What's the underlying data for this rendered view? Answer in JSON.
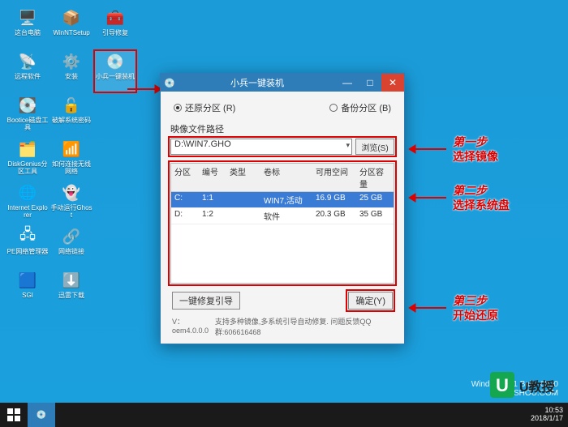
{
  "desktop": {
    "icons": [
      {
        "name": "this-pc",
        "label": "这台电脑",
        "glyph": "🖥️"
      },
      {
        "name": "winntsetup",
        "label": "WinNTSetup",
        "glyph": "📦"
      },
      {
        "name": "boot-repair",
        "label": "引导修复",
        "glyph": "🧰"
      },
      {
        "name": "remote-software",
        "label": "远程软件",
        "glyph": "📡"
      },
      {
        "name": "install",
        "label": "安装",
        "glyph": "⚙️"
      },
      {
        "name": "xiaobing",
        "label": "小兵一键装机",
        "glyph": "💿",
        "hl": true
      },
      {
        "name": "bootice",
        "label": "Bootice磁盘工具",
        "glyph": "💽"
      },
      {
        "name": "crack-pwd",
        "label": "破解系统密码",
        "glyph": "🔓"
      },
      {
        "name": "blank1",
        "label": "",
        "glyph": ""
      },
      {
        "name": "diskgenius",
        "label": "DiskGenius分区工具",
        "glyph": "🗂️"
      },
      {
        "name": "wifi-connect",
        "label": "如何连接无线网络",
        "glyph": "📶"
      },
      {
        "name": "blank2",
        "label": "",
        "glyph": ""
      },
      {
        "name": "ie",
        "label": "Internet Explorer",
        "glyph": "🌐"
      },
      {
        "name": "manual-ghost",
        "label": "手动运行Ghost",
        "glyph": "👻"
      },
      {
        "name": "blank3",
        "label": "",
        "glyph": ""
      },
      {
        "name": "pe-net",
        "label": "PE网络管理器",
        "glyph": "🖧"
      },
      {
        "name": "net-link",
        "label": "网络链接",
        "glyph": "🔗"
      },
      {
        "name": "blank4",
        "label": "",
        "glyph": ""
      },
      {
        "name": "sgi",
        "label": "SGI",
        "glyph": "🟦"
      },
      {
        "name": "xunlei",
        "label": "迅雷下载",
        "glyph": "⬇️"
      },
      {
        "name": "blank5",
        "label": "",
        "glyph": ""
      }
    ]
  },
  "window": {
    "title": "小兵一键装机",
    "restore_label": "还原分区 (R)",
    "backup_label": "备份分区 (B)",
    "path_section": "映像文件路径",
    "path_value": "D:\\WIN7.GHO",
    "browse": "浏览(S)",
    "cols": {
      "c1": "分区",
      "c2": "编号",
      "c3": "类型",
      "c4": "卷标",
      "c5": "可用空间",
      "c6": "分区容量"
    },
    "rows": [
      {
        "p": "C:",
        "n": "1:1",
        "t": "",
        "v": "WIN7,活动",
        "free": "16.9 GB",
        "cap": "25 GB",
        "sel": true
      },
      {
        "p": "D:",
        "n": "1:2",
        "t": "",
        "v": "软件",
        "free": "20.3 GB",
        "cap": "35 GB",
        "sel": false
      }
    ],
    "repair_btn": "一键修复引导",
    "ok_btn": "确定(Y)",
    "version": "V：oem4.0.0.0",
    "support": "支持多种镜像,多系统引导自动修复. 问题反馈QQ群:606616468"
  },
  "steps": {
    "s1a": "第一步",
    "s1b": "选择镜像",
    "s2a": "第二步",
    "s2b": "选择系统盘",
    "s3a": "第三步",
    "s3b": "开始还原"
  },
  "taskbar": {
    "time": "10:53",
    "date": "2018/1/17",
    "win_hint": "Windows 8.1 Build 6900"
  },
  "watermark": "XIAOSHOU.COM",
  "ulogo": "U教授"
}
